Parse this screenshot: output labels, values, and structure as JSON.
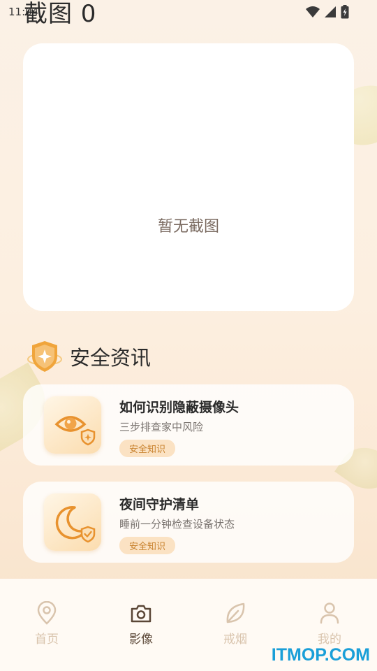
{
  "status_bar": {
    "time": "11:04"
  },
  "header": {
    "title": "截图 0"
  },
  "screenshot_panel": {
    "empty_text": "暂无截图"
  },
  "section": {
    "title": "安全资讯",
    "icon": "shield-star-icon"
  },
  "news": [
    {
      "title": "如何识别隐蔽摄像头",
      "subtitle": "三步排查家中风险",
      "tag": "安全知识",
      "icon": "eye-shield-icon"
    },
    {
      "title": "夜间守护清单",
      "subtitle": "睡前一分钟检查设备状态",
      "tag": "安全知识",
      "icon": "moon-shield-icon"
    }
  ],
  "tabs": [
    {
      "label": "首页",
      "icon": "location-pin-icon",
      "active": false
    },
    {
      "label": "影像",
      "icon": "camera-icon",
      "active": true
    },
    {
      "label": "戒烟",
      "icon": "leaf-icon",
      "active": false
    },
    {
      "label": "我的",
      "icon": "person-icon",
      "active": false
    }
  ],
  "watermark": "ITMOP.COM",
  "colors": {
    "accent": "#f0a53c",
    "tag_bg": "#fbe2c3",
    "tag_text": "#c9832f",
    "tab_active": "#5a4636",
    "tab_inactive": "#d9c4ad",
    "watermark": "#1a9fd8"
  }
}
